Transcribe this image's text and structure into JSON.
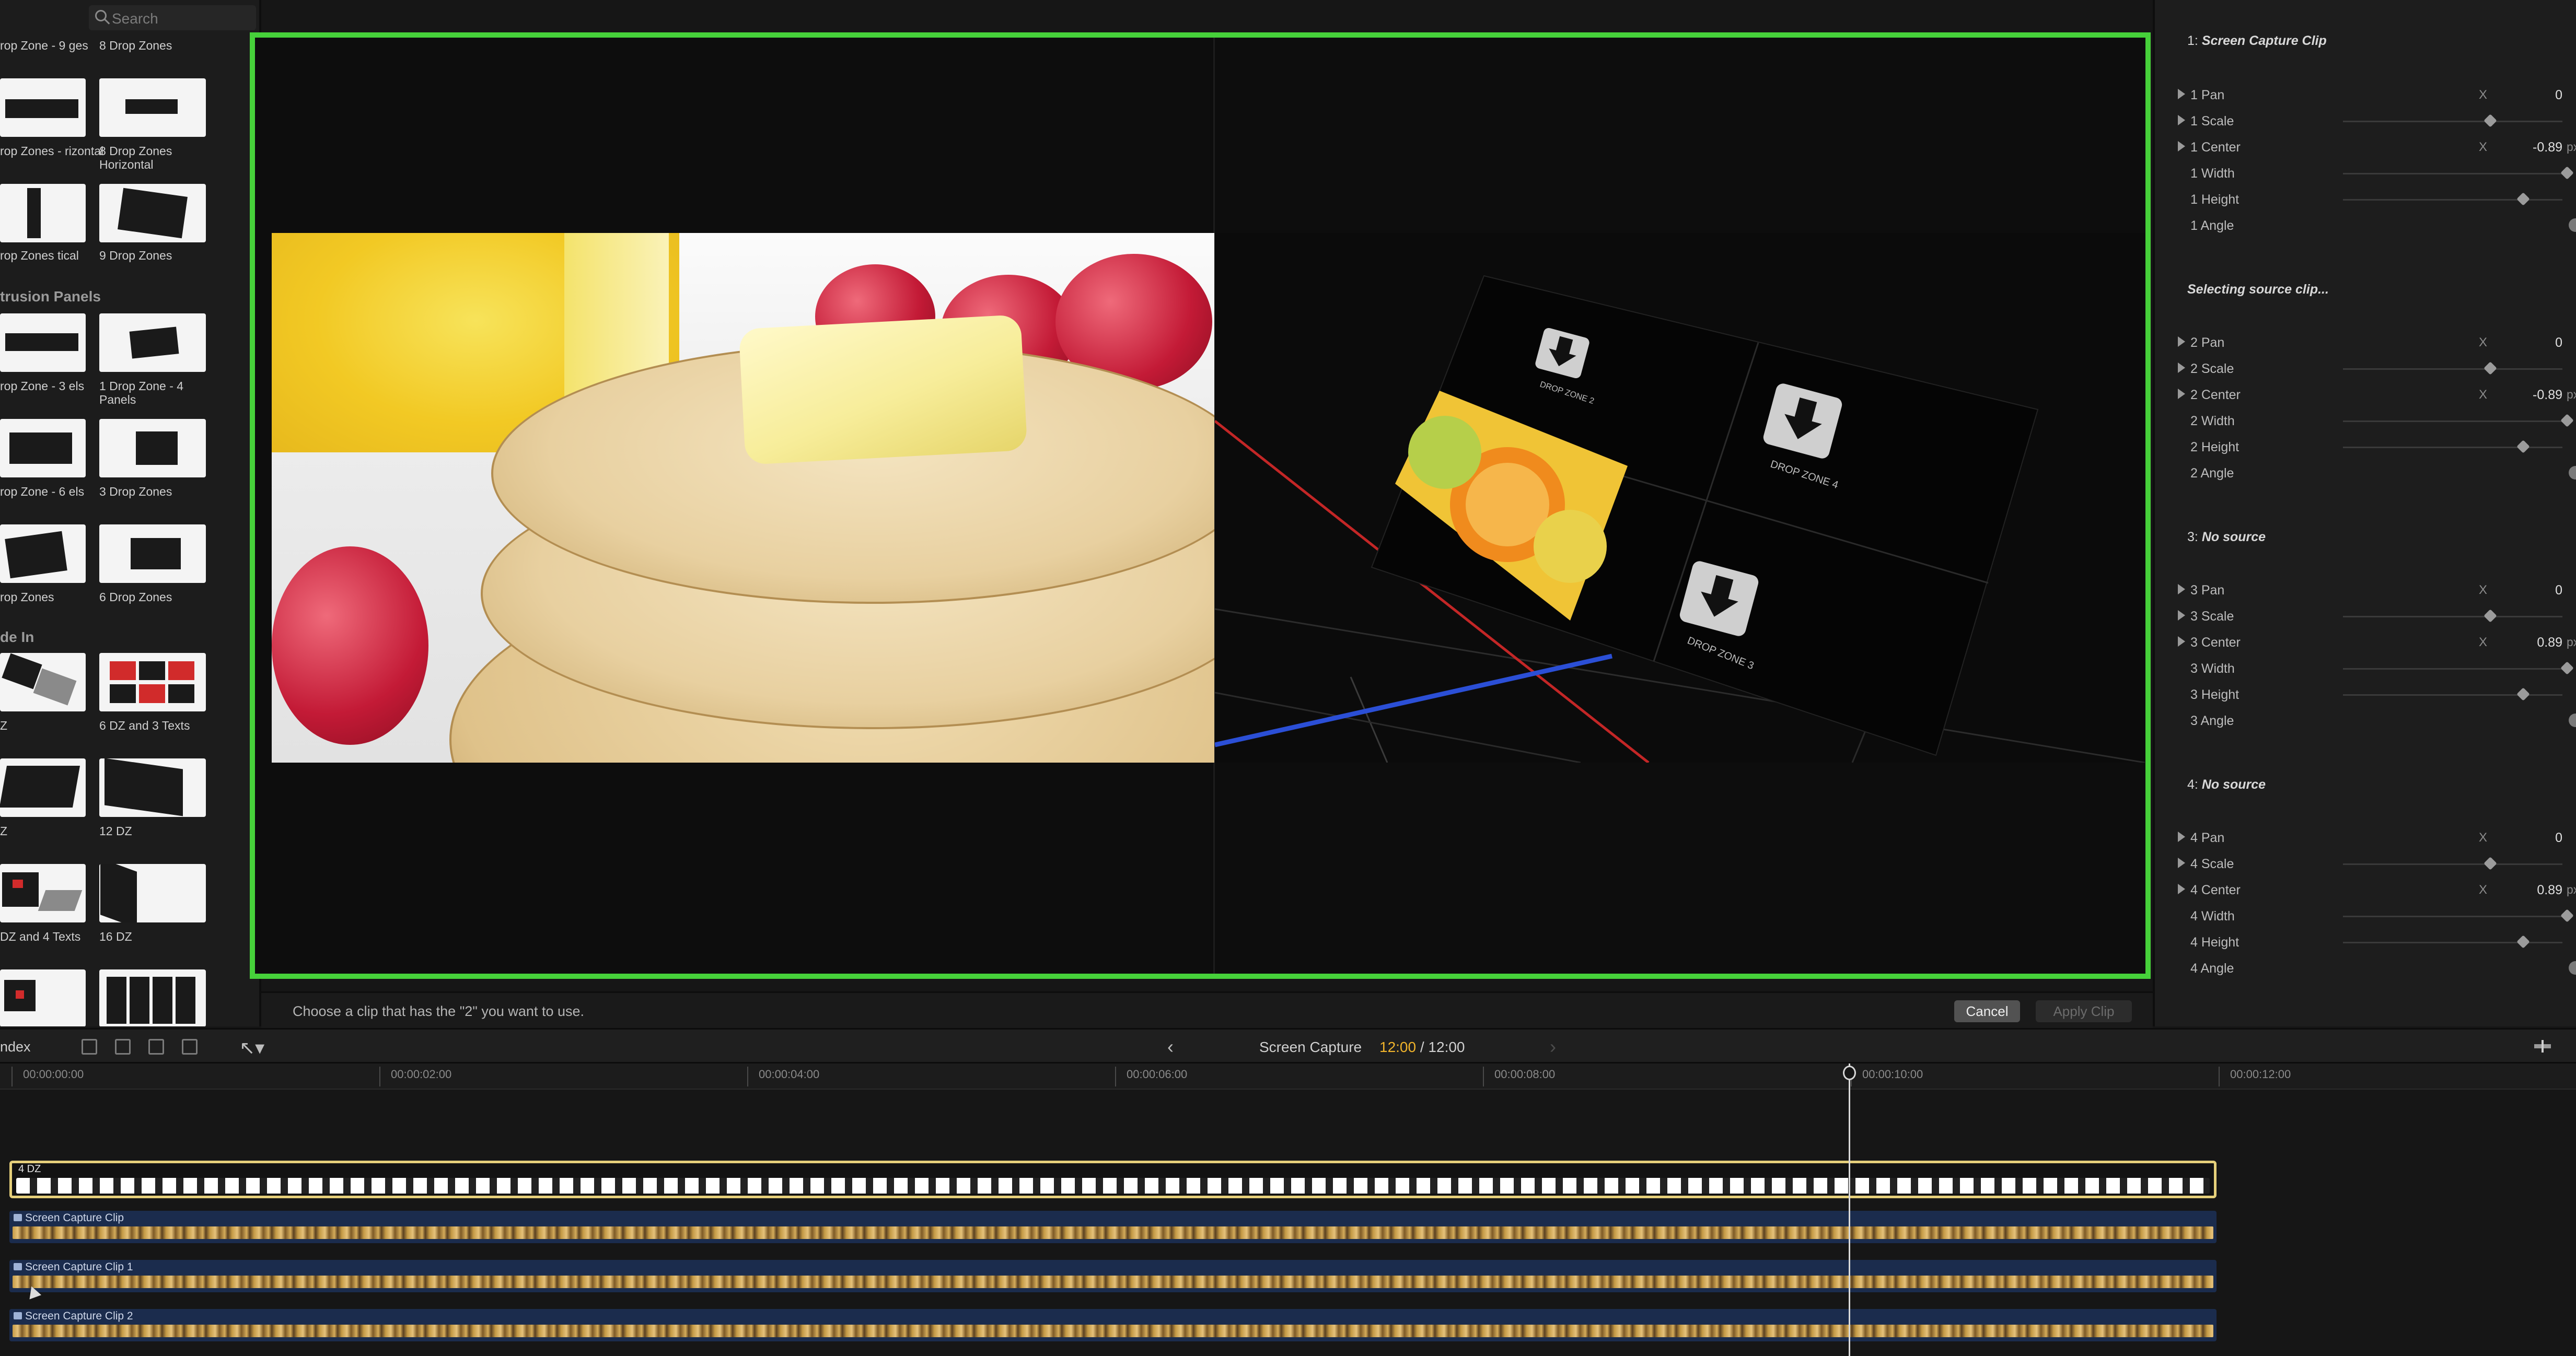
{
  "browser": {
    "search_placeholder": "Search",
    "sections": [
      {
        "label": "trusion Panels"
      },
      {
        "label": "de In"
      }
    ],
    "items": [
      {
        "label": "rop Zone - 9 ges"
      },
      {
        "label": "8 Drop Zones"
      },
      {
        "label": "rop Zones - rizontal"
      },
      {
        "label": "8 Drop Zones Horizontal"
      },
      {
        "label": "rop Zones tical"
      },
      {
        "label": "9 Drop Zones"
      },
      {
        "label": "rop Zone - 3 els"
      },
      {
        "label": "1 Drop Zone - 4 Panels"
      },
      {
        "label": "rop Zone - 6 els"
      },
      {
        "label": "3 Drop Zones"
      },
      {
        "label": "rop Zones"
      },
      {
        "label": "6 Drop Zones"
      },
      {
        "label": "Z"
      },
      {
        "label": "6 DZ and 3 Texts"
      },
      {
        "label": "Z"
      },
      {
        "label": "12 DZ"
      },
      {
        "label": "DZ and 4 Texts"
      },
      {
        "label": "16 DZ"
      }
    ]
  },
  "inspector": {
    "sections": [
      {
        "num": "1:",
        "title": "Screen Capture Clip",
        "rows": [
          {
            "name": "1 Pan",
            "axis": "X",
            "value": "0",
            "unit": ""
          },
          {
            "name": "1 Scale",
            "axis": "",
            "value": "",
            "unit": "",
            "knob": 0.65
          },
          {
            "name": "1 Center",
            "axis": "X",
            "value": "-0.89",
            "unit": "px"
          },
          {
            "name": "1 Width",
            "axis": "",
            "value": "",
            "unit": "",
            "knob": 1.0
          },
          {
            "name": "1 Height",
            "axis": "",
            "value": "",
            "unit": "",
            "knob": 0.8
          },
          {
            "name": "1 Angle",
            "axis": "",
            "value": "",
            "unit": ""
          }
        ]
      },
      {
        "num": "",
        "title": "Selecting source clip...",
        "rows": [
          {
            "name": "2 Pan",
            "axis": "X",
            "value": "0",
            "unit": ""
          },
          {
            "name": "2 Scale",
            "axis": "",
            "value": "",
            "unit": "",
            "knob": 0.65
          },
          {
            "name": "2 Center",
            "axis": "X",
            "value": "-0.89",
            "unit": "px"
          },
          {
            "name": "2 Width",
            "axis": "",
            "value": "",
            "unit": "",
            "knob": 1.0
          },
          {
            "name": "2 Height",
            "axis": "",
            "value": "",
            "unit": "",
            "knob": 0.8
          },
          {
            "name": "2 Angle",
            "axis": "",
            "value": "",
            "unit": ""
          }
        ]
      },
      {
        "num": "3:",
        "title": "No source",
        "rows": [
          {
            "name": "3 Pan",
            "axis": "X",
            "value": "0",
            "unit": ""
          },
          {
            "name": "3 Scale",
            "axis": "",
            "value": "",
            "unit": "",
            "knob": 0.65
          },
          {
            "name": "3 Center",
            "axis": "X",
            "value": "0.89",
            "unit": "px"
          },
          {
            "name": "3 Width",
            "axis": "",
            "value": "",
            "unit": "",
            "knob": 1.0
          },
          {
            "name": "3 Height",
            "axis": "",
            "value": "",
            "unit": "",
            "knob": 0.8
          },
          {
            "name": "3 Angle",
            "axis": "",
            "value": "",
            "unit": ""
          }
        ]
      },
      {
        "num": "4:",
        "title": "No source",
        "rows": [
          {
            "name": "4 Pan",
            "axis": "X",
            "value": "0",
            "unit": ""
          },
          {
            "name": "4 Scale",
            "axis": "",
            "value": "",
            "unit": "",
            "knob": 0.65
          },
          {
            "name": "4 Center",
            "axis": "X",
            "value": "0.89",
            "unit": "px"
          },
          {
            "name": "4 Width",
            "axis": "",
            "value": "",
            "unit": "",
            "knob": 1.0
          },
          {
            "name": "4 Height",
            "axis": "",
            "value": "",
            "unit": "",
            "knob": 0.8
          },
          {
            "name": "4 Angle",
            "axis": "",
            "value": "",
            "unit": ""
          }
        ]
      }
    ]
  },
  "viewer": {
    "drop_zone_labels": [
      "DROP ZONE 2",
      "DROP ZONE 4",
      "DROP ZONE 3"
    ]
  },
  "statusbar": {
    "hint": "Choose a clip that has the \"2\" you want to use.",
    "cancel_label": "Cancel",
    "apply_label": "Apply Clip"
  },
  "timeline_header": {
    "index_label": "ndex",
    "project_name": "Screen Capture",
    "timecode_current": "12:00",
    "timecode_separator": "/",
    "timecode_duration": "12:00"
  },
  "timeline": {
    "ruler_labels": [
      "00:00:00:00",
      "00:00:02:00",
      "00:00:04:00",
      "00:00:06:00",
      "00:00:08:00",
      "00:00:10:00",
      "00:00:12:00"
    ],
    "tracks": [
      {
        "label": "4 DZ"
      },
      {
        "label": "Screen Capture Clip"
      },
      {
        "label": "Screen Capture Clip 1"
      },
      {
        "label": "Screen Capture Clip 2"
      }
    ]
  },
  "colors": {
    "viewer_border": "#46d13a",
    "timecode": "#f1b42b",
    "selected_clip_border": "#e5cf7a",
    "clip_band": "#1b2c4d"
  }
}
